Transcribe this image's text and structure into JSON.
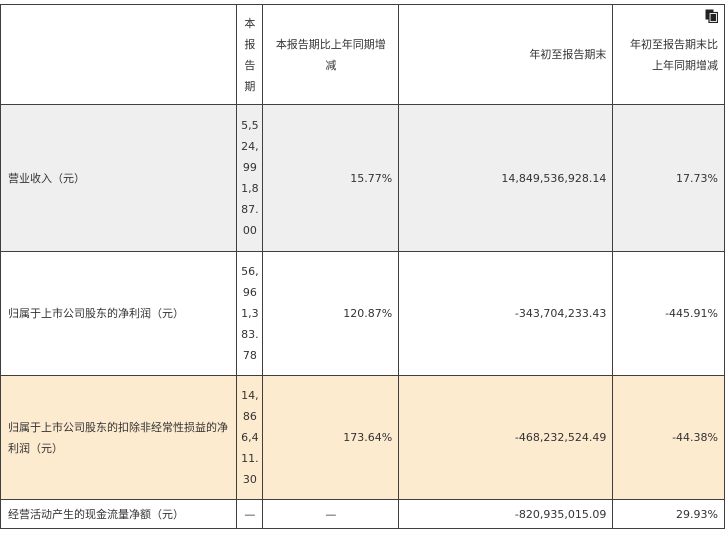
{
  "header": {
    "col1": "",
    "col2": "本报告期",
    "col3": "本报告期比上年同期增减",
    "col4": "年初至报告期末",
    "col5": "年初至报告期末比上年同期增减"
  },
  "rows": [
    {
      "label": "营业收入（元）",
      "current": "5,524,991,887.00",
      "yoy": "15.77%",
      "ytd": "14,849,536,928.14",
      "ytd_yoy": "17.73%"
    },
    {
      "label": "归属于上市公司股东的净利润（元）",
      "current": "56,961,383.78",
      "yoy": "120.87%",
      "ytd": "-343,704,233.43",
      "ytd_yoy": "-445.91%"
    },
    {
      "label": "归属于上市公司股东的扣除非经常性损益的净利润（元）",
      "current": "14,866,411.30",
      "yoy": "173.64%",
      "ytd": "-468,232,524.49",
      "ytd_yoy": "-44.38%"
    },
    {
      "label": "经营活动产生的现金流量净额（元）",
      "current": "—",
      "yoy": "—",
      "ytd": "-820,935,015.09",
      "ytd_yoy": "29.93%"
    }
  ],
  "colors": {
    "highlight_row": "#fdebd0",
    "shaded_row": "#efefef",
    "border": "#3f3f3f"
  },
  "icons": {
    "header_corner": "copy-icon"
  }
}
